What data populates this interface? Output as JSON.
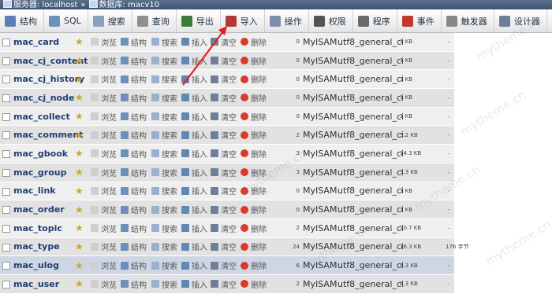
{
  "breadcrumb": {
    "server": "服务器: localhost",
    "database": "数据库: macv10",
    "separator": "»"
  },
  "tabs": [
    {
      "label": "结构",
      "icon": "structure-icon",
      "color": "#5b7fb5"
    },
    {
      "label": "SQL",
      "icon": "sql-icon",
      "color": "#6e8fbf"
    },
    {
      "label": "搜索",
      "icon": "search-icon",
      "color": "#8aa0c0"
    },
    {
      "label": "查询",
      "icon": "query-icon",
      "color": "#8f8f8f"
    },
    {
      "label": "导出",
      "icon": "export-icon",
      "color": "#3a7a3a"
    },
    {
      "label": "导入",
      "icon": "import-icon",
      "color": "#b33838"
    },
    {
      "label": "操作",
      "icon": "operations-icon",
      "color": "#7a8ea8"
    },
    {
      "label": "权限",
      "icon": "privileges-icon",
      "color": "#555555"
    },
    {
      "label": "程序",
      "icon": "routines-icon",
      "color": "#6a6a6a"
    },
    {
      "label": "事件",
      "icon": "events-icon",
      "color": "#c0392b"
    },
    {
      "label": "触发器",
      "icon": "triggers-icon",
      "color": "#888888"
    },
    {
      "label": "设计器",
      "icon": "designer-icon",
      "color": "#6b7f99"
    }
  ],
  "actions": {
    "browse": "浏览",
    "structure": "结构",
    "search": "搜索",
    "insert": "插入",
    "empty": "清空",
    "drop": "删除"
  },
  "tables": [
    {
      "name": "mac_card",
      "rows": "0",
      "engine": "MyISAM",
      "collation": "utf8_general_ci",
      "size": "1 KB",
      "overhead": "-"
    },
    {
      "name": "mac_cj_content",
      "rows": "0",
      "engine": "MyISAM",
      "collation": "utf8_general_ci",
      "size": "1 KB",
      "overhead": "-"
    },
    {
      "name": "mac_cj_history",
      "rows": "0",
      "engine": "MyISAM",
      "collation": "utf8_general_ci",
      "size": "1 KB",
      "overhead": "-"
    },
    {
      "name": "mac_cj_node",
      "rows": "0",
      "engine": "MyISAM",
      "collation": "utf8_general_ci",
      "size": "1 KB",
      "overhead": "-"
    },
    {
      "name": "mac_collect",
      "rows": "0",
      "engine": "MyISAM",
      "collation": "utf8_general_ci",
      "size": "1 KB",
      "overhead": "-"
    },
    {
      "name": "mac_comment",
      "rows": "2",
      "engine": "MyISAM",
      "collation": "utf8_general_ci",
      "size": "5.2 KB",
      "overhead": "-"
    },
    {
      "name": "mac_gbook",
      "rows": "3",
      "engine": "MyISAM",
      "collation": "utf8_general_ci",
      "size": "14.3 KB",
      "overhead": "-"
    },
    {
      "name": "mac_group",
      "rows": "3",
      "engine": "MyISAM",
      "collation": "utf8_general_ci",
      "size": "3.3 KB",
      "overhead": "-"
    },
    {
      "name": "mac_link",
      "rows": "0",
      "engine": "MyISAM",
      "collation": "utf8_general_ci",
      "size": "1 KB",
      "overhead": "-"
    },
    {
      "name": "mac_order",
      "rows": "0",
      "engine": "MyISAM",
      "collation": "utf8_general_ci",
      "size": "1 KB",
      "overhead": "-"
    },
    {
      "name": "mac_topic",
      "rows": "2",
      "engine": "MyISAM",
      "collation": "utf8_general_ci",
      "size": "20.7 KB",
      "overhead": "-"
    },
    {
      "name": "mac_type",
      "rows": "24",
      "engine": "MyISAM",
      "collation": "utf8_general_ci",
      "size": "16.3 KB",
      "overhead": "176 字节"
    },
    {
      "name": "mac_ulog",
      "rows": "6",
      "engine": "MyISAM",
      "collation": "utf8_general_ci",
      "size": "6.3 KB",
      "overhead": "-"
    },
    {
      "name": "mac_user",
      "rows": "2",
      "engine": "MyISAM",
      "collation": "utf8_general_ci",
      "size": "6.3 KB",
      "overhead": "-"
    }
  ],
  "highlighted_row": "mac_ulog",
  "watermark_text": "mytheme.cn",
  "colors": {
    "table_name": "#1f3f73",
    "arrow": "#e02020",
    "star": "#d1a51f",
    "drop_icon": "#d93a2b"
  }
}
